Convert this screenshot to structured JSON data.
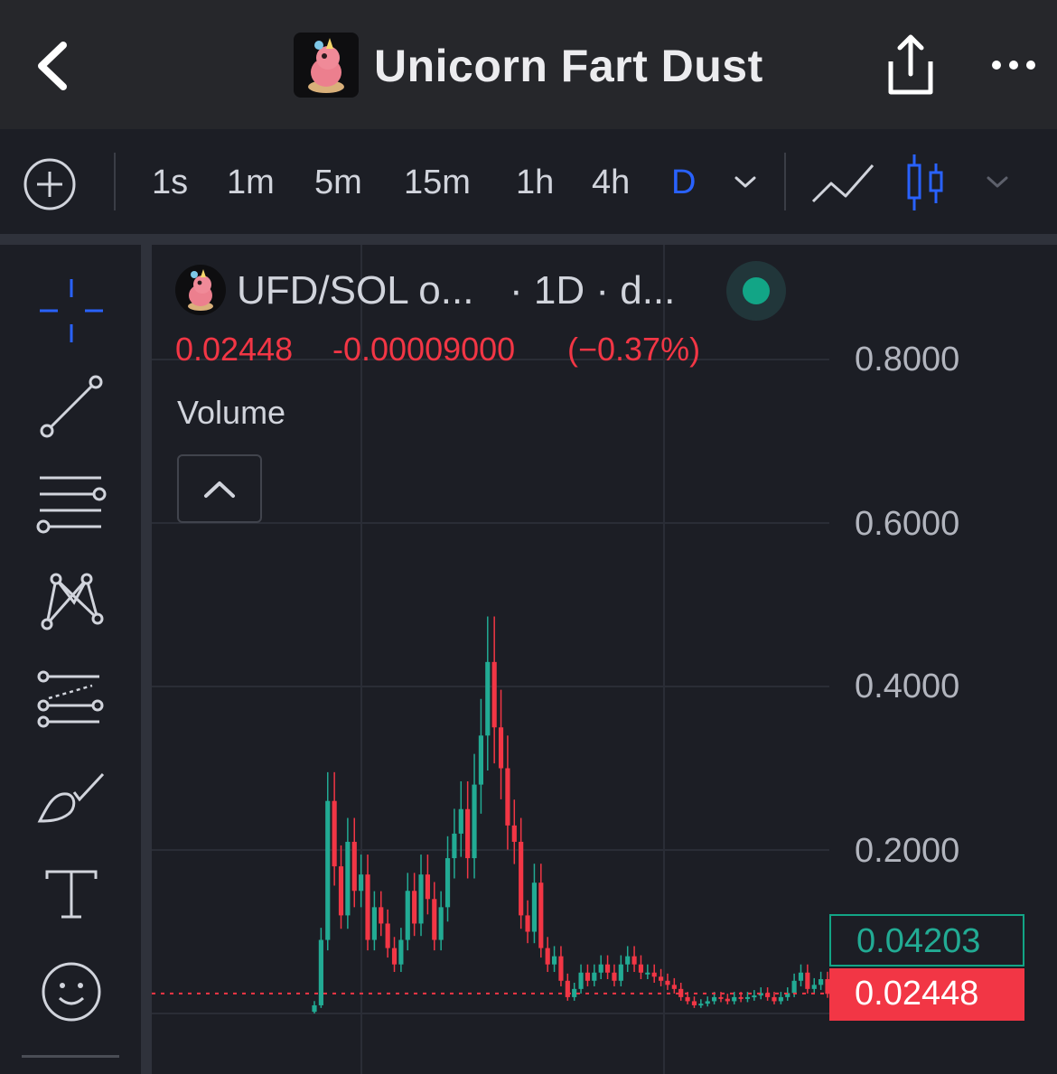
{
  "header": {
    "title": "Unicorn Fart Dust",
    "back_icon": "chevron-left-icon",
    "share_icon": "share-icon",
    "more_icon": "more-horizontal-icon"
  },
  "toolbar": {
    "intervals": [
      {
        "label": "1s",
        "active": false
      },
      {
        "label": "1m",
        "active": false
      },
      {
        "label": "5m",
        "active": false
      },
      {
        "label": "15m",
        "active": false
      },
      {
        "label": "1h",
        "active": false
      },
      {
        "label": "4h",
        "active": false
      },
      {
        "label": "D",
        "active": true
      }
    ],
    "active_color": "#2962ff",
    "chart_types": [
      "line-chart-icon",
      "candlestick-icon"
    ]
  },
  "drawing_tools": [
    "crosshair-icon",
    "trend-line-icon",
    "horizontal-lines-icon",
    "pattern-icon",
    "fib-retracement-icon",
    "brush-icon",
    "text-icon",
    "emoji-icon"
  ],
  "legend": {
    "symbol": "UFD/SOL o...",
    "interval_source": "· 1D · d...",
    "status_color": "#12a586",
    "last": "0.02448",
    "change": "-0.00009000",
    "change_pct": "(−0.37%)",
    "volume_label": "Volume"
  },
  "price_axis": {
    "labels": [
      "0.8000",
      "0.6000",
      "0.4000",
      "0.2000"
    ],
    "bid_tag": "0.04203",
    "last_tag": "0.02448",
    "up_color": "#22ab94",
    "down_color": "#f23645"
  },
  "chart_data": {
    "type": "candlestick",
    "ylim": [
      0,
      0.9
    ],
    "y_ticks": [
      0.2,
      0.4,
      0.6,
      0.8
    ],
    "last_price": 0.02448,
    "series": [
      {
        "values": [
          0.01,
          0.09,
          0.26,
          0.18,
          0.12,
          0.21,
          0.15,
          0.17,
          0.09,
          0.13,
          0.11,
          0.08,
          0.06,
          0.09,
          0.15,
          0.11,
          0.17,
          0.14,
          0.09,
          0.13,
          0.19,
          0.22,
          0.25,
          0.19,
          0.28,
          0.34,
          0.43,
          0.35,
          0.3,
          0.23,
          0.21,
          0.12,
          0.1,
          0.16,
          0.08,
          0.06,
          0.07,
          0.04,
          0.02,
          0.03,
          0.05,
          0.04,
          0.05,
          0.06,
          0.05,
          0.04,
          0.06,
          0.07,
          0.06,
          0.05,
          0.05,
          0.045,
          0.04,
          0.035,
          0.03,
          0.02,
          0.015,
          0.01,
          0.012,
          0.015,
          0.02,
          0.018,
          0.015,
          0.02,
          0.018,
          0.02,
          0.022,
          0.025,
          0.02,
          0.015,
          0.02,
          0.025,
          0.04,
          0.05,
          0.03,
          0.035,
          0.042,
          0.024
        ]
      }
    ]
  }
}
